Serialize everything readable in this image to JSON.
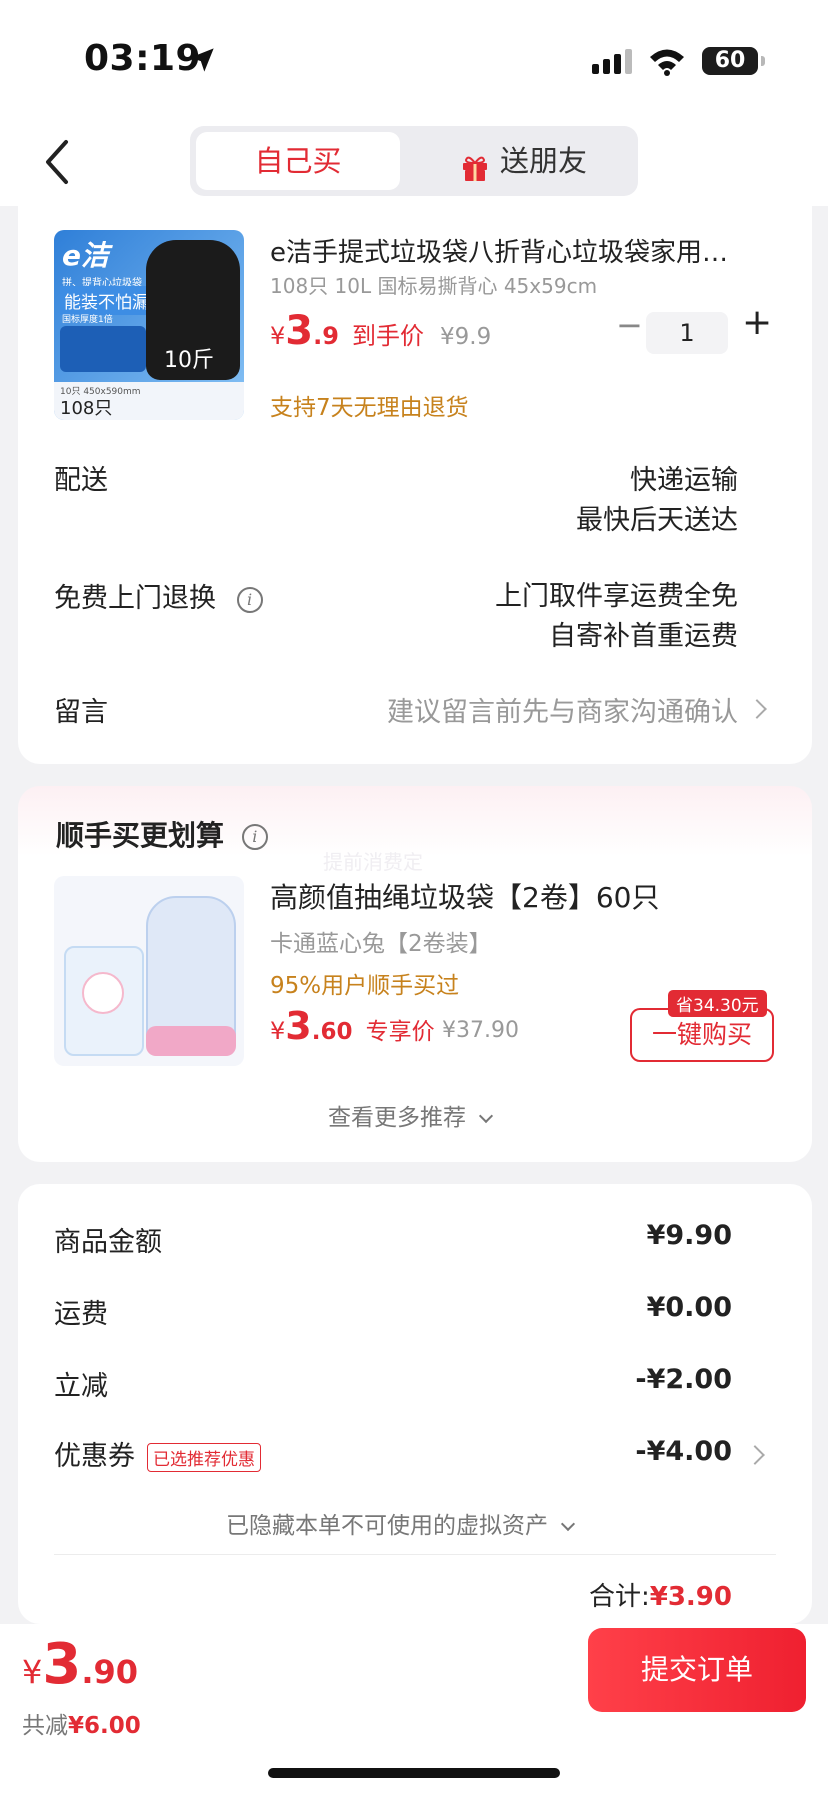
{
  "status": {
    "time": "03:19",
    "battery": "60"
  },
  "header": {
    "tab_self": "自己买",
    "tab_gift": "送朋友"
  },
  "product": {
    "image_text": {
      "brand": "e洁",
      "badge": "能装不怕漏",
      "small1": "拼、提背心垃圾袋",
      "small2": "国标厚度1倍",
      "weight": "10斤",
      "count": "108只",
      "spec": "10只 450x590mm"
    },
    "title": "e洁手提式垃圾袋八折背心垃圾袋家用…",
    "spec": "108只 10L 国标易撕背心 45x59cm",
    "price_symbol": "¥",
    "price_int": "3",
    "price_dec": ".9",
    "price_label": "到手价",
    "original_price": "¥9.9",
    "quantity": "1",
    "qty_minus": "−",
    "qty_plus": "+",
    "return_policy": "支持7天无理由退货"
  },
  "order_info": {
    "delivery_label": "配送",
    "delivery_line1": "快递运输",
    "delivery_line2": "最快后天送达",
    "return_label": "免费上门退换",
    "return_line1": "上门取件享运费全免",
    "return_line2": "自寄补首重运费",
    "message_label": "留言",
    "message_placeholder": "建议留言前先与商家沟通确认"
  },
  "recommend": {
    "title": "顺手买更划算",
    "faint_text": "提前消费定",
    "item_title": "高颜值抽绳垃圾袋【2卷】60只",
    "item_spec": "卡通蓝心兔【2卷装】",
    "item_social": "95%用户顺手买过",
    "price_symbol": "¥",
    "price_int": "3",
    "price_dec": ".60",
    "price_label": "专享价",
    "original_price": "¥37.90",
    "save_badge": "省34.30元",
    "buy_button": "一键购买",
    "more": "查看更多推荐"
  },
  "summary": {
    "goods_label": "商品金额",
    "goods_value": "¥9.90",
    "shipping_label": "运费",
    "shipping_value": "¥0.00",
    "discount_label": "立减",
    "discount_value": "-¥2.00",
    "coupon_label": "优惠券",
    "coupon_tag": "已选推荐优惠",
    "coupon_value": "-¥4.00",
    "hidden_assets": "已隐藏本单不可使用的虚拟资产",
    "total_label": "合计:",
    "total_value": "¥3.90"
  },
  "footer": {
    "price_symbol": "¥",
    "price_int": "3",
    "price_dec": ".90",
    "saved_label": "共减",
    "saved_value": "¥6.00",
    "submit": "提交订单"
  },
  "colors": {
    "accent": "#e22b34",
    "orange": "#c7821d",
    "background": "#f2f2f4"
  }
}
